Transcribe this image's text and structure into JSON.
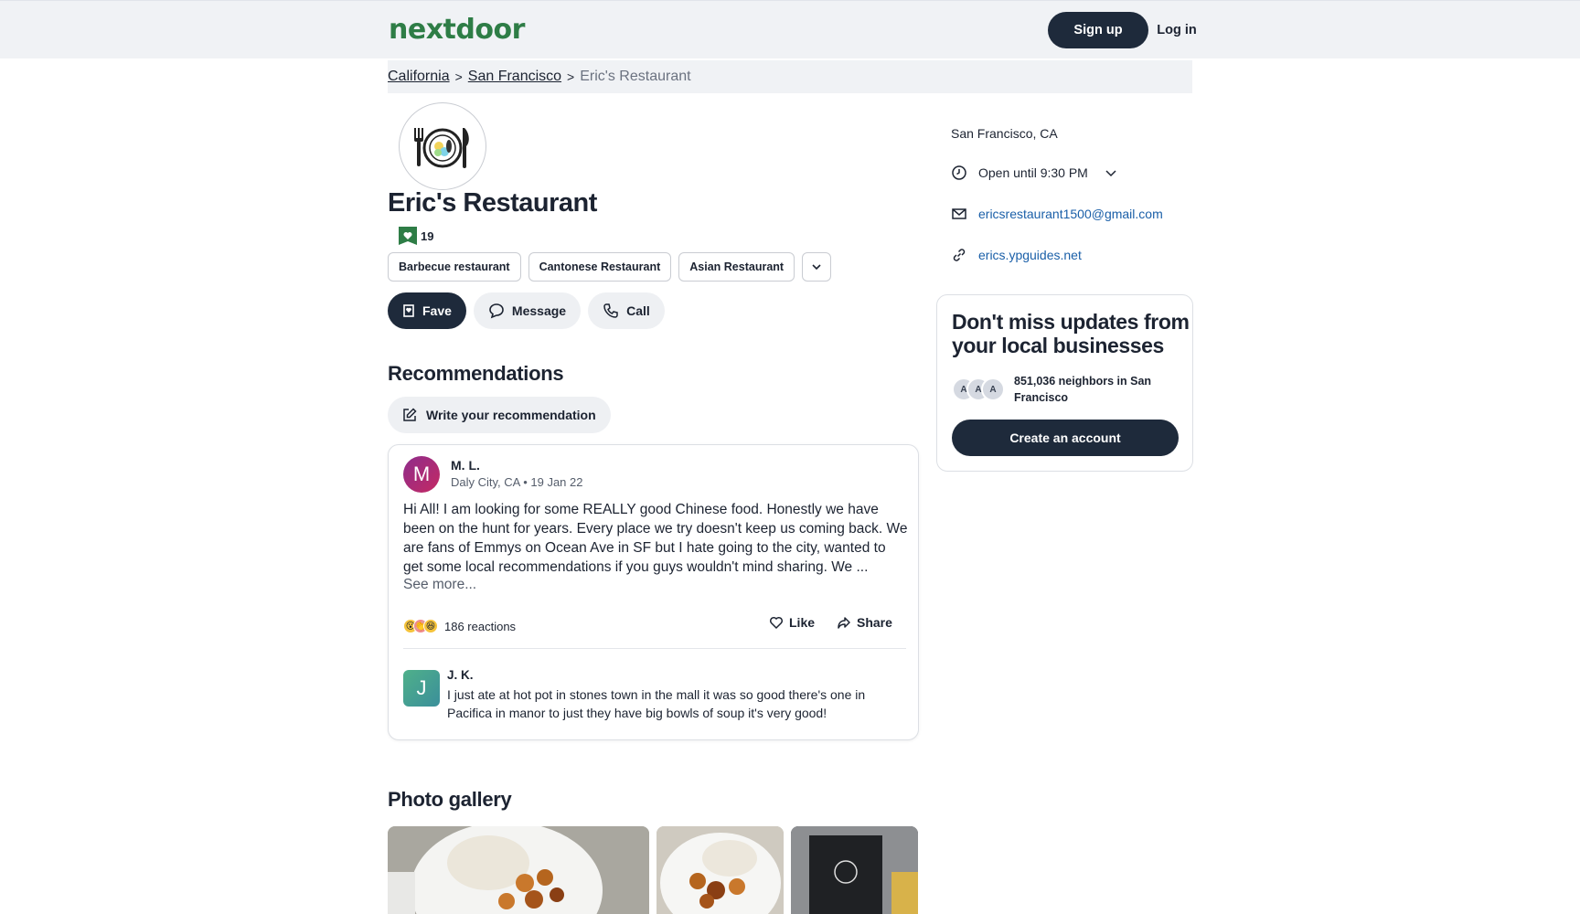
{
  "header": {
    "logo": "nextdoor",
    "signup_label": "Sign up",
    "login_label": "Log in"
  },
  "breadcrumb": {
    "state": "California",
    "city": "San Francisco",
    "current": "Eric's Restaurant"
  },
  "business": {
    "name": "Eric's Restaurant",
    "fave_count": "19",
    "tags": [
      "Barbecue restaurant",
      "Cantonese Restaurant",
      "Asian Restaurant"
    ],
    "actions": {
      "fave": "Fave",
      "message": "Message",
      "call": "Call"
    }
  },
  "recommendations": {
    "title": "Recommendations",
    "write_label": "Write your recommendation",
    "post": {
      "avatar_letter": "M",
      "author": "M. L.",
      "meta": "Daly City, CA • 19 Jan 22",
      "text": "Hi All! I am looking for some REALLY good Chinese food. Honestly we have been on the hunt for years. Every place we try doesn't keep us coming back. We are fans of Emmys on Ocean Ave in SF but I hate going to the city, wanted to get some local recommendations if you guys wouldn't mind sharing. We ...",
      "see_more": "See more...",
      "reactions": "186 reactions",
      "like_label": "Like",
      "share_label": "Share"
    },
    "reply": {
      "avatar_letter": "J",
      "author": "J. K.",
      "text": "I just ate at hot pot in stones town in the mall it was so good there's one in Pacifica in manor to just they have big bowls of soup it's very good!"
    }
  },
  "gallery": {
    "title": "Photo gallery"
  },
  "sidebar": {
    "location": "San Francisco, CA",
    "hours": "Open until 9:30 PM",
    "email": "ericsrestaurant1500@gmail.com",
    "website": "erics.ypguides.net"
  },
  "cta": {
    "title": "Don't miss updates from your local businesses",
    "avatar_letters": [
      "A",
      "A",
      "A"
    ],
    "neighbors": "851,036 neighbors in San Francisco",
    "button": "Create an account"
  },
  "colors": {
    "brand_green": "#2e7d46",
    "dark_button": "#1e2a3b",
    "link_blue": "#1a5fa8"
  }
}
